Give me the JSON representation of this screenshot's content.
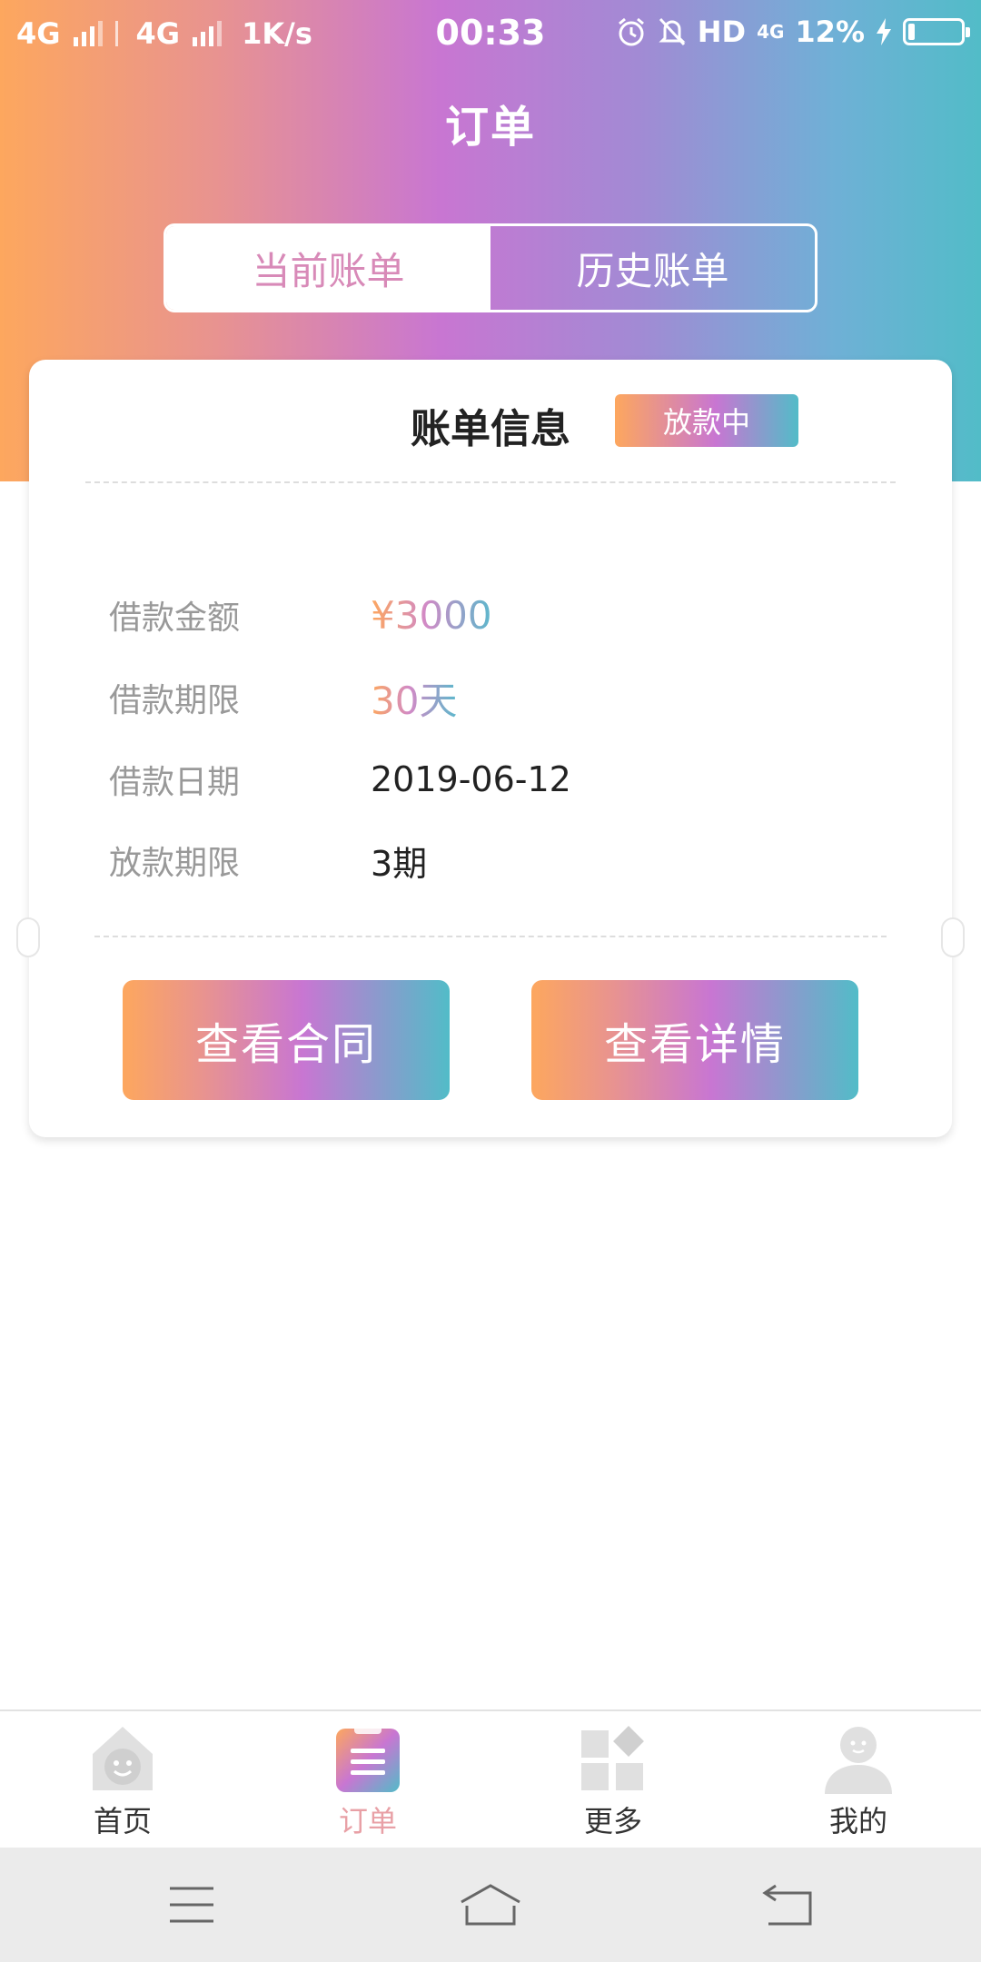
{
  "status_bar": {
    "sim1": "4G",
    "sim2": "4G",
    "speed": "1K/s",
    "time": "00:33",
    "hd": "HD",
    "network_right": "4G",
    "battery": "12%",
    "battery_level": 0.12
  },
  "header": {
    "title": "订单"
  },
  "tabs": {
    "current": "当前账单",
    "history": "历史账单",
    "active": "current"
  },
  "card": {
    "title": "账单信息",
    "badge": "放款中",
    "rows": [
      {
        "label": "借款金额",
        "value": "¥3000"
      },
      {
        "label": "借款期限",
        "value": "30天"
      },
      {
        "label": "借款日期",
        "value": "2019-06-12"
      },
      {
        "label": "放款期限",
        "value": "3期"
      }
    ],
    "buttons": {
      "contract": "查看合同",
      "detail": "查看详情"
    }
  },
  "bottom_nav": {
    "items": [
      {
        "label": "首页",
        "icon": "home-icon"
      },
      {
        "label": "订单",
        "icon": "order-icon",
        "active": true
      },
      {
        "label": "更多",
        "icon": "more-icon"
      },
      {
        "label": "我的",
        "icon": "profile-icon"
      }
    ]
  },
  "system_nav": {
    "menu": "menu-icon",
    "home": "home-outline-icon",
    "back": "back-icon"
  },
  "colors": {
    "gradient_start": "#fda75e",
    "gradient_mid": "#c876d2",
    "gradient_end": "#52bcc8",
    "label_gray": "#999999",
    "tab_active_text": "#d88ab8"
  }
}
